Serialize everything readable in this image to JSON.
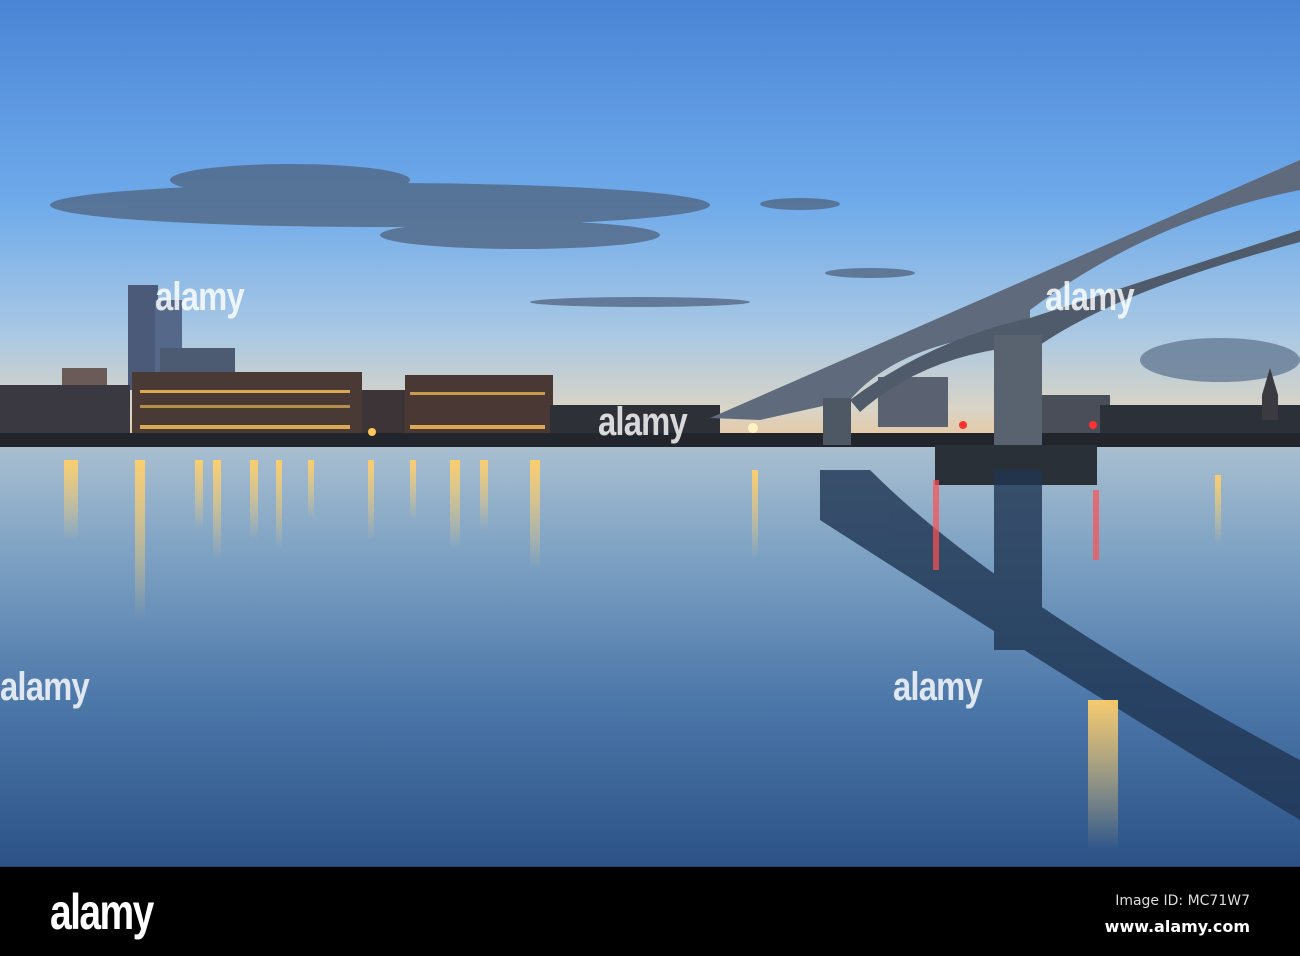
{
  "photo": {
    "subject": "",
    "colors": {
      "sky_top": "#4a86d8",
      "sky_mid": "#78b0ec",
      "horizon": "#e6cfae",
      "water_top": "#9ab4cc",
      "water_bottom": "#2c5588",
      "light": "#ffc65a"
    }
  },
  "watermark": {
    "text": "alamy"
  },
  "footer": {
    "logo": "alamy",
    "image_id": "Image ID: MC71W7",
    "url": "www.alamy.com"
  }
}
